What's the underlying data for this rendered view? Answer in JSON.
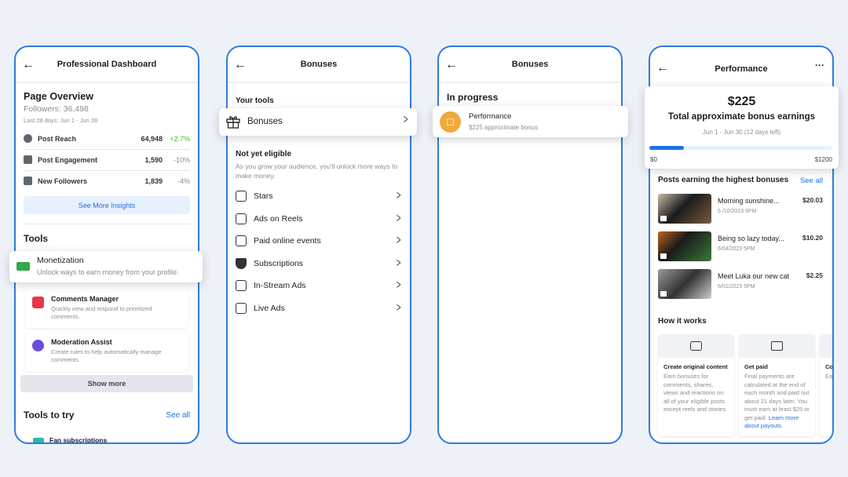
{
  "colors": {
    "accent": "#1b74e4",
    "frame": "#2f7be0",
    "positive": "#42b72a"
  },
  "dashboard": {
    "title": "Professional Dashboard",
    "overview_title": "Page Overview",
    "followers": "Followers: 36,498",
    "range": "Last 28 days: Jun 1 - Jun 28",
    "metrics": [
      {
        "icon": "globe-icon",
        "label": "Post Reach",
        "value": "64,948",
        "change": "+2.7%"
      },
      {
        "icon": "people-icon",
        "label": "Post Engagement",
        "value": "1,590",
        "change": "-10%"
      },
      {
        "icon": "followers-icon",
        "label": "New Followers",
        "value": "1,839",
        "change": "-4%"
      }
    ],
    "insights_button": "See More Insights",
    "tools_title": "Tools",
    "monetization": {
      "title": "Monetization",
      "desc": "Unlock ways to earn money from your profile."
    },
    "tools": [
      {
        "title": "Comments Manager",
        "desc": "Quickly view and respond to prioritized comments."
      },
      {
        "title": "Moderation Assist",
        "desc": "Create rules to help automatically manage comments."
      }
    ],
    "show_more": "Show more",
    "try_title": "Tools to try",
    "see_all": "See all",
    "fan_subs": "Fan subscriptions"
  },
  "bonuses": {
    "title": "Bonuses",
    "your_tools": "Your tools",
    "bonuses_item": "Bonuses",
    "not_eligible": "Not yet eligible",
    "not_eligible_desc": "As you grow your audience, you'll unlock more ways to make money.",
    "items": [
      {
        "icon": "stars-icon",
        "label": "Stars"
      },
      {
        "icon": "reels-icon",
        "label": "Ads on Reels"
      },
      {
        "icon": "ticket-icon",
        "label": "Paid online events"
      },
      {
        "icon": "subscriptions-icon",
        "label": "Subscriptions"
      },
      {
        "icon": "megaphone-icon",
        "label": "In-Stream Ads"
      },
      {
        "icon": "live-megaphone-icon",
        "label": "Live Ads"
      }
    ]
  },
  "in_progress": {
    "title": "Bonuses",
    "section": "In progress",
    "item_title": "Performance",
    "item_sub": "$225 approximate bonus"
  },
  "performance": {
    "title": "Performance",
    "amount": "$225",
    "label": "Total approximate bonus earnings",
    "range": "Jun 1 - Jun 30 (12 days left)",
    "progress_value": 225,
    "progress_max": 1200,
    "min_label": "$0",
    "max_label": "$1200",
    "posts_title": "Posts earning the highest bonuses",
    "see_all": "See all",
    "posts": [
      {
        "title": "Morning sunshine...",
        "date": "6 /10/2023 5PM",
        "amount": "$20.03"
      },
      {
        "title": "Being so lazy today...",
        "date": "6/04/2023 5PM",
        "amount": "$10.20"
      },
      {
        "title": "Meet Luka our new cat",
        "date": "6/01/2023 5PM",
        "amount": "$2.25"
      }
    ],
    "how_title": "How it works",
    "how": [
      {
        "title": "Create original content",
        "desc": "Earn bonuses for comments, shares, views and reactions on all of your eligible posts except reels and stories",
        "link": ""
      },
      {
        "title": "Get paid",
        "desc": "Final payments are calculated at the end of each month and paid out about 21 days later. You must earn at least $25 to get paid.",
        "link": "Learn more about payouts"
      },
      {
        "title": "Co",
        "desc": "Ea yo ch",
        "link": ""
      }
    ]
  }
}
